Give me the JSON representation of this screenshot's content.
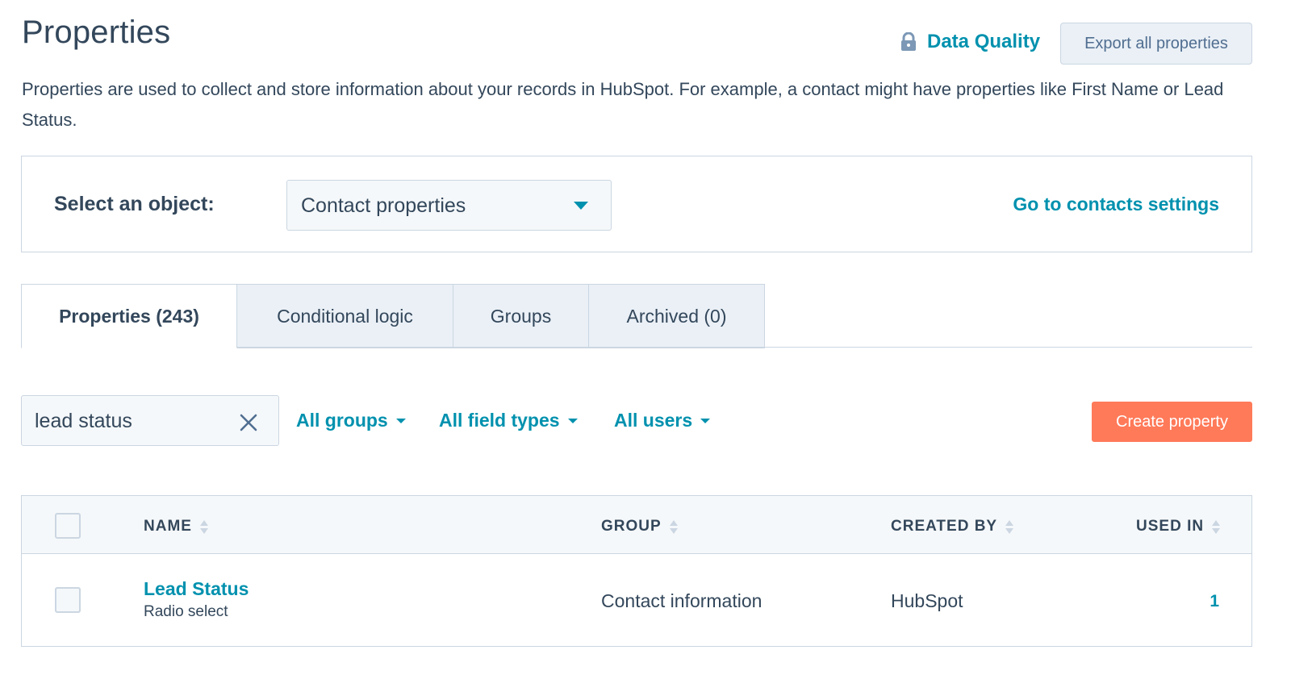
{
  "header": {
    "title": "Properties",
    "data_quality_label": "Data Quality",
    "export_label": "Export all properties",
    "description": "Properties are used to collect and store information about your records in HubSpot. For example, a contact might have properties like First Name or Lead Status."
  },
  "object_selector": {
    "label": "Select an object:",
    "selected": "Contact properties",
    "settings_link": "Go to contacts settings"
  },
  "tabs": [
    {
      "label": "Properties (243)",
      "active": true
    },
    {
      "label": "Conditional logic",
      "active": false
    },
    {
      "label": "Groups",
      "active": false
    },
    {
      "label": "Archived (0)",
      "active": false
    }
  ],
  "filters": {
    "search_value": "lead status",
    "groups": "All groups",
    "field_types": "All field types",
    "users": "All users",
    "create_label": "Create property"
  },
  "table": {
    "columns": {
      "name": "NAME",
      "group": "GROUP",
      "created_by": "CREATED BY",
      "used_in": "USED IN"
    },
    "rows": [
      {
        "name": "Lead Status",
        "type": "Radio select",
        "group": "Contact information",
        "created_by": "HubSpot",
        "used_in": "1"
      }
    ]
  },
  "colors": {
    "accent": "#0091ae",
    "primary_button": "#ff7a59",
    "text": "#33475b",
    "border": "#cbd6e2"
  },
  "icons": [
    "lock-icon",
    "close-icon",
    "chevron-down-icon",
    "sort-icon"
  ]
}
